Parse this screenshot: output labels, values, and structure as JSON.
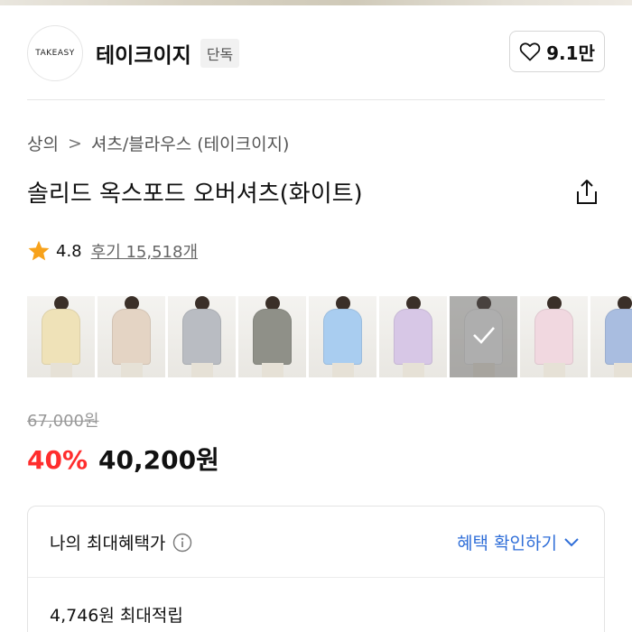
{
  "store": {
    "logo_text": "TAKEASY",
    "name": "테이크이지",
    "badge": "단독",
    "like_count": "9.1만"
  },
  "breadcrumb": {
    "category": "상의",
    "separator": ">",
    "subcategory": "셔츠/블라우스 (테이크이지)"
  },
  "product": {
    "title": "솔리드 옥스포드 오버셔츠(화이트)"
  },
  "rating": {
    "value": "4.8",
    "review_text": "후기 15,518개"
  },
  "color_options": [
    {
      "color": "#efe2b8"
    },
    {
      "color": "#e4d4c4"
    },
    {
      "color": "#b9bcc2"
    },
    {
      "color": "#8f9088"
    },
    {
      "color": "#a9cdf0"
    },
    {
      "color": "#d7c7e6"
    },
    {
      "color": "#f2f2f2",
      "selected": true
    },
    {
      "color": "#f1d8e0"
    },
    {
      "color": "#a9bde0"
    }
  ],
  "price": {
    "original": "67,000원",
    "discount": "40%",
    "sale": "40,200원"
  },
  "benefit": {
    "title": "나의 최대혜택가",
    "link": "혜택 확인하기",
    "points": "4,746원 최대적립"
  },
  "colors": {
    "discount_red": "#ff2d2d",
    "link_blue": "#2f6ed8",
    "star_orange": "#f7a21b"
  }
}
